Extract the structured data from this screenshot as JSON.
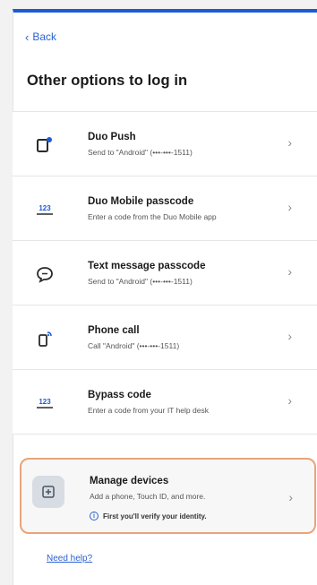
{
  "nav": {
    "back_label": "Back"
  },
  "page": {
    "title": "Other options to log in"
  },
  "options": [
    {
      "title": "Duo Push",
      "subtitle": "Send to \"Android\" (•••-•••-1511)",
      "icon": "push-phone-icon"
    },
    {
      "title": "Duo Mobile passcode",
      "subtitle": "Enter a code from the Duo Mobile app",
      "icon": "passcode-icon"
    },
    {
      "title": "Text message passcode",
      "subtitle": "Send to \"Android\" (•••-•••-1511)",
      "icon": "chat-bubble-icon"
    },
    {
      "title": "Phone call",
      "subtitle": "Call \"Android\" (•••-•••-1511)",
      "icon": "phone-call-icon"
    },
    {
      "title": "Bypass code",
      "subtitle": "Enter a code from your IT help desk",
      "icon": "passcode-icon"
    }
  ],
  "manage": {
    "title": "Manage devices",
    "subtitle": "Add a phone, Touch ID, and more.",
    "note": "First you'll verify your identity."
  },
  "footer": {
    "help_label": "Need help?"
  },
  "colors": {
    "accent": "#1c5bd6",
    "link": "#2a62d2",
    "highlight_border": "#e8a47a"
  }
}
